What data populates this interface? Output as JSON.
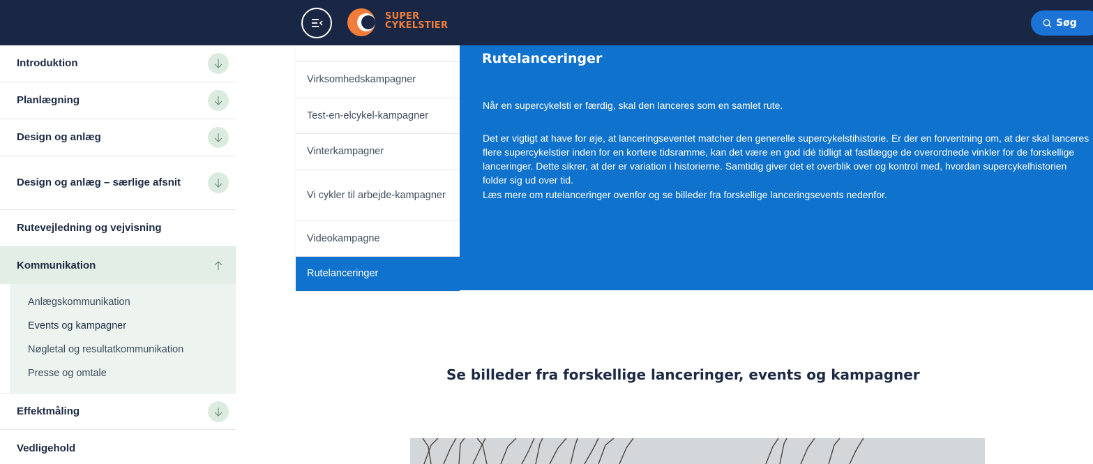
{
  "header": {
    "logo_line1": "SUPER",
    "logo_line2": "CYKELSTIER",
    "search_label": "Søg",
    "colors": {
      "bg": "#1a2744",
      "logo": "#f07d3a",
      "search": "#1b74d5"
    }
  },
  "sidebar": {
    "items": [
      {
        "label": "Introduktion"
      },
      {
        "label": "Planlægning"
      },
      {
        "label": "Design og anlæg"
      },
      {
        "label": "Design og anlæg – særlige afsnit"
      },
      {
        "label": "Rutevejledning og vejvisning"
      },
      {
        "label": "Kommunikation"
      },
      {
        "label": "Effektmåling"
      },
      {
        "label": "Vedligehold"
      }
    ],
    "subitems": [
      {
        "label": "Anlægskommunikation"
      },
      {
        "label": "Events og kampagner"
      },
      {
        "label": "Nøgletal og resultatkommunikation"
      },
      {
        "label": "Presse og omtale"
      }
    ]
  },
  "midmenu": {
    "items": [
      {
        "label": "Virksomhedskampagner"
      },
      {
        "label": "Test-en-elcykel-kampagner"
      },
      {
        "label": "Vinterkampagner"
      },
      {
        "label": "Vi cykler til arbejde-kampagner"
      },
      {
        "label": "Videokampagne"
      },
      {
        "label": "Rutelanceringer"
      }
    ]
  },
  "panel": {
    "title": "Rutelanceringer",
    "p1": "Når en supercykelsti er færdig, skal den lanceres som en samlet rute.",
    "p2": "Det er vigtigt at have for øje, at lanceringseventet matcher den generelle supercykelstihistorie. Er der en forventning om, at der skal lanceres flere supercykelstier inden for en kortere tidsramme, kan det være en god idé tidligt at fastlægge de overordnede vinkler for de forskellige lanceringer. Dette sikrer, at der er variation i historierne. Samtidig giver det et overblik over og kontrol med, hvordan supercykelhistorien folder sig ud over tid.",
    "p3": "Læs mere om rutelanceringer ovenfor og se billeder fra forskellige lanceringsevents nedenfor.",
    "color": "#0f72cc"
  },
  "gallery": {
    "title": "Se billeder fra forskellige lanceringer, events og kampagner"
  }
}
